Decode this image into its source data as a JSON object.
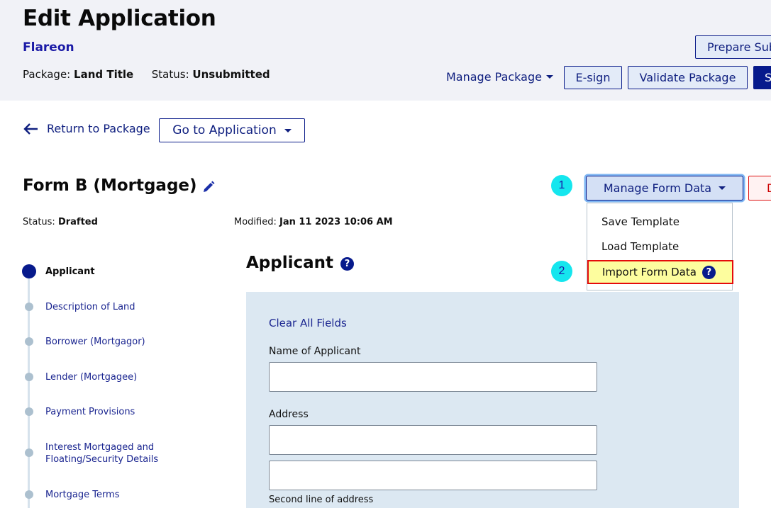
{
  "header": {
    "title": "Edit Application",
    "app_name": "Flareon",
    "package_label": "Package:",
    "package_value": "Land Title",
    "status_label": "Status:",
    "status_value": "Unsubmitted",
    "buttons": {
      "prepare_submission": "Prepare Sub",
      "manage_package": "Manage Package",
      "esign": "E-sign",
      "validate_package": "Validate Package",
      "submit_partial": "S"
    }
  },
  "nav": {
    "return_label": "Return to Package",
    "goto_application": "Go to Application"
  },
  "form": {
    "title": "Form B (Mortgage)",
    "status_label": "Status:",
    "status_value": "Drafted",
    "modified_label": "Modified:",
    "modified_value": "Jan 11 2023 10:06 AM",
    "manage_form_data": "Manage Form Data",
    "delete_partial": "D",
    "dropdown_items": [
      "Save Template",
      "Load Template",
      "Import Form Data"
    ],
    "highlight_color": "#fdfd9e",
    "highlight_border": "#e50b0b"
  },
  "annotations": {
    "marker_1": "1",
    "marker_2": "2"
  },
  "stepper": {
    "steps": [
      {
        "label": "Applicant",
        "active": true
      },
      {
        "label": "Description of Land",
        "active": false
      },
      {
        "label": "Borrower (Mortgagor)",
        "active": false
      },
      {
        "label": "Lender (Mortgagee)",
        "active": false
      },
      {
        "label": "Payment Provisions",
        "active": false
      },
      {
        "label": "Interest Mortgaged and Floating/Security Details",
        "active": false
      },
      {
        "label": "Mortgage Terms",
        "active": false
      }
    ]
  },
  "section": {
    "title": "Applicant",
    "help": "?",
    "clear_all": "Clear All Fields",
    "fields": {
      "name_label": "Name of Applicant",
      "name_value": "",
      "address_label": "Address",
      "address_line1_value": "",
      "address_line2_value": "",
      "address_helper": "Second line of address"
    }
  },
  "colors": {
    "primary": "#071a8c",
    "link": "#1a2590",
    "header_bg": "#f1f2f7",
    "panel_bg": "#dce8f2",
    "marker": "#15e6ee"
  }
}
